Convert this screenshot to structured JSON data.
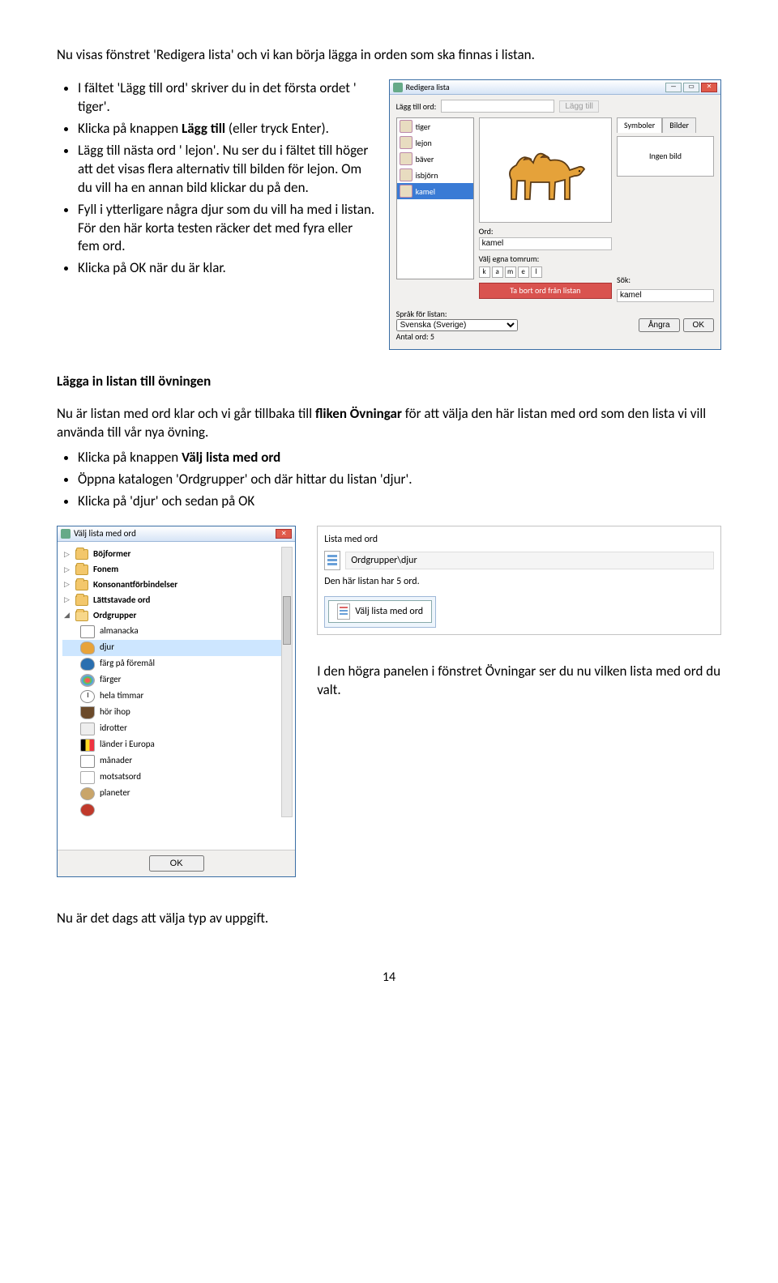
{
  "intro": "Nu visas fönstret 'Redigera lista' och vi kan börja lägga in orden som ska finnas i listan.",
  "bullets1": [
    {
      "pre": "I fältet 'Lägg till ord' skriver du in det första ordet ' tiger'.",
      "post": ""
    },
    {
      "pre": "Klicka på knappen ",
      "bold": "Lägg till",
      "post": " (eller tryck Enter)."
    },
    {
      "pre": "Lägg till nästa ord ' lejon'. Nu ser du i fältet till höger att det visas flera alternativ till bilden för lejon. Om du vill ha en annan bild klickar du på den.",
      "post": ""
    },
    {
      "pre": "Fyll i ytterligare några djur som du vill ha med i listan. För den här korta testen räcker det med fyra eller fem ord.",
      "post": ""
    },
    {
      "pre": "Klicka på OK när du är klar.",
      "post": ""
    }
  ],
  "rl": {
    "title": "Redigera lista",
    "addLabel": "Lägg till ord:",
    "addBtn": "Lägg till",
    "items": [
      "tiger",
      "lejon",
      "bäver",
      "isbjörn",
      "kamel"
    ],
    "tabSymboler": "Symboler",
    "tabBilder": "Bilder",
    "noImage": "Ingen bild",
    "ordLabel": "Ord:",
    "ordValue": "kamel",
    "valjLabel": "Välj egna tomrum:",
    "letters": [
      "k",
      "a",
      "m",
      "e",
      "l"
    ],
    "deleteBtn": "Ta bort ord från listan",
    "sokLabel": "Sök:",
    "sokValue": "kamel",
    "sprakLabel": "Språk för listan:",
    "sprakValue": "Svenska (Sverige)",
    "antal": "Antal ord: 5",
    "angra": "Ångra",
    "ok": "OK"
  },
  "section2": {
    "title": "Lägga in listan till övningen",
    "body": "Nu är listan med ord klar och vi går tillbaka till ",
    "bodyBold": "fliken Övningar",
    "body2": " för att välja den här listan med ord som den lista vi vill använda till vår nya övning.",
    "bullets": [
      {
        "pre": "Klicka på knappen ",
        "bold": "Välj lista med ord",
        "post": ""
      },
      {
        "pre": "Öppna katalogen 'Ordgrupper' och där hittar du listan 'djur'.",
        "post": ""
      },
      {
        "pre": "Klicka på 'djur' och sedan på OK",
        "post": ""
      }
    ]
  },
  "vl": {
    "title": "Välj lista med ord",
    "folders": [
      "Böjformer",
      "Fonem",
      "Konsonantförbindelser",
      "Lättstavade ord",
      "Ordgrupper"
    ],
    "items": [
      "almanacka",
      "djur",
      "färg på föremål",
      "färger",
      "hela timmar",
      "hör ihop",
      "idrotter",
      "länder i Europa",
      "månader",
      "motsatsord",
      "planeter"
    ],
    "okBtn": "OK"
  },
  "lmo": {
    "title": "Lista med ord",
    "path": "Ordgrupper\\djur",
    "count": "Den här listan har 5 ord.",
    "btn": "Välj lista med ord"
  },
  "caption": "I den högra panelen i fönstret Övningar ser du nu vilken lista med ord du valt.",
  "final": "Nu är det dags att välja typ av uppgift.",
  "pageNum": "14"
}
